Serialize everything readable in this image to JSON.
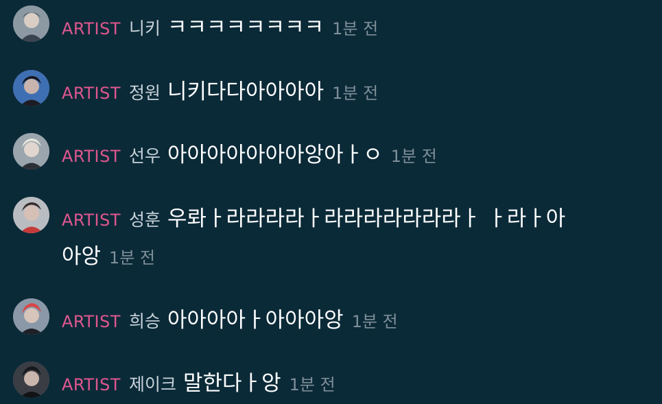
{
  "badge_label": "ARTIST",
  "messages": [
    {
      "name": "니키",
      "text": "ㅋㅋㅋㅋㅋㅋㅋㅋ",
      "time": "1분 전"
    },
    {
      "name": "정원",
      "text": "니키다다아아아아",
      "time": "1분 전"
    },
    {
      "name": "선우",
      "text": "아아아아아아아앙아ㅏㅇ",
      "time": "1분 전"
    },
    {
      "name": "성훈",
      "text": "우롸ㅏ라라라라ㅏ라라라라라라라ㅏ ㅏ라ㅏ아",
      "text_cont": "아앙",
      "time": "1분 전"
    },
    {
      "name": "희승",
      "text": "아아아아ㅏ아아아앙",
      "time": "1분 전"
    },
    {
      "name": "제이크",
      "text": "말한다ㅏ앙",
      "time": "1분 전"
    }
  ],
  "colors": {
    "background": "#0b2a38",
    "badge": "#e0578f",
    "name": "#c8d3da",
    "message": "#ffffff",
    "time": "#7f8f99"
  },
  "icons": [
    "avatar"
  ]
}
